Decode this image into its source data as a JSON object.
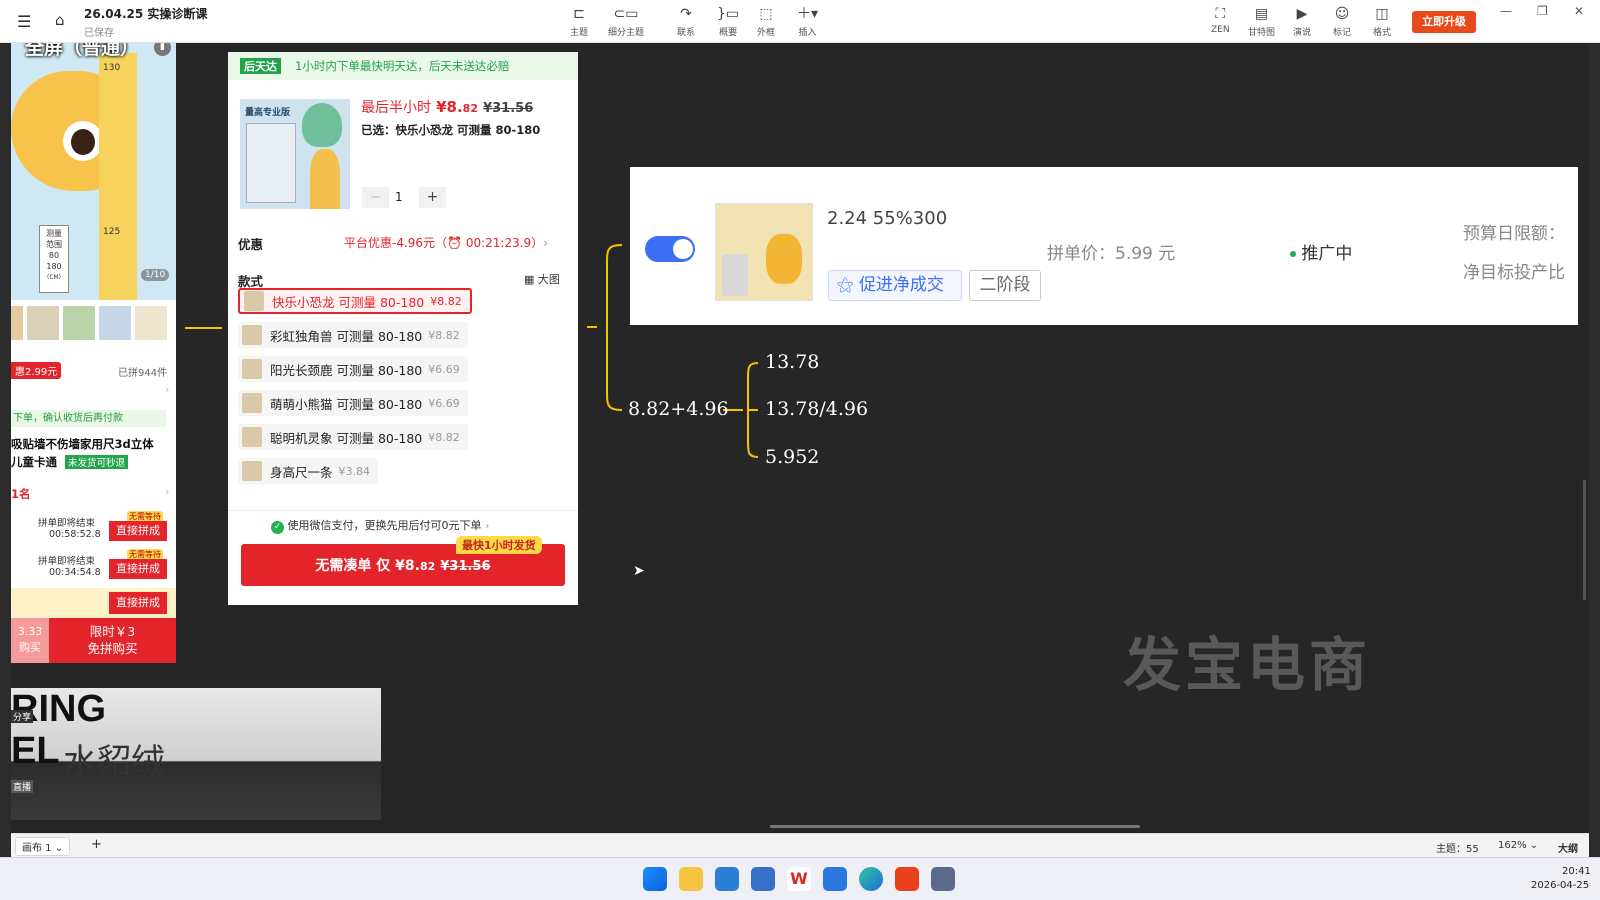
{
  "titlebar": {
    "doc_title": "26.04.25 实操诊断课",
    "save_status": "已保存",
    "upgrade_label": "立即升级"
  },
  "fullscreen_tag": "全屏（普通）",
  "toolbar": {
    "tools": [
      {
        "label": "主题",
        "icon": "topic-icon"
      },
      {
        "label": "细分主题",
        "icon": "subtopic-icon"
      },
      {
        "label": "联系",
        "icon": "relationship-icon"
      },
      {
        "label": "概要",
        "icon": "summary-icon"
      },
      {
        "label": "外框",
        "icon": "boundary-icon"
      },
      {
        "label": "插入",
        "icon": "insert-icon"
      }
    ],
    "right_tools": [
      {
        "label": "ZEN",
        "icon": "zen-icon"
      },
      {
        "label": "甘特图",
        "icon": "gantt-icon"
      },
      {
        "label": "演说",
        "icon": "present-icon"
      },
      {
        "label": "标记",
        "icon": "marker-icon"
      },
      {
        "label": "格式",
        "icon": "format-icon"
      }
    ]
  },
  "left_card": {
    "ruler_marks": [
      "130",
      "125"
    ],
    "measure_label_1": "测量",
    "measure_label_2": "范围",
    "measure_range_lo": "80",
    "measure_range_hi": "180",
    "measure_unit": "（CM）",
    "pager": "1/10",
    "coupon": "惠2.99元",
    "group_count": "已拼944件",
    "pay_later": "下单，确认收货后再付款",
    "desc_line1": "吸贴墙不伤墙家用尺3d立体",
    "desc_line2": "儿童卡通",
    "refund_tag": "未发货可秒退",
    "rank": "1名",
    "group_rows": [
      {
        "label": "拼单即将结束",
        "time": "00:58:52.8",
        "badge": "无需等待",
        "btn": "直接拼成"
      },
      {
        "label": "拼单即将结束",
        "time": "00:34:54.8",
        "badge": "无需等待",
        "btn": "直接拼成"
      }
    ],
    "join_btn": "直接拼成",
    "price_left": "3.33",
    "price_left_sub": "购买",
    "limited_line1": "限时￥3",
    "limited_line2": "免拼购买"
  },
  "bottom_image": {
    "line1": "RING",
    "line2": "EL",
    "line2_cn": "水貂绒",
    "side_tag_top": "分享",
    "side_tag_bottom": "直播"
  },
  "product": {
    "delivery_tag": "后天达",
    "delivery_text": "1小时内下单最快明天达，后天未送达必赔",
    "price_prefix": "最后半小时",
    "price_main": "¥8.",
    "price_cents": "82",
    "price_original": "¥31.56",
    "selected_text": "已选：快乐小恐龙 可测量 80-180",
    "qty_minus": "−",
    "qty_value": "1",
    "qty_plus": "+",
    "discount_label": "优惠",
    "discount_value": "平台优惠-4.96元（",
    "discount_timer": "00:21:23.9",
    "discount_close": "）",
    "style_label": "款式",
    "big_image": "大图",
    "variants": [
      {
        "name": "快乐小恐龙 可测量 80-180",
        "price": "¥8.82",
        "selected": true
      },
      {
        "name": "彩虹独角兽 可测量 80-180",
        "price": "¥8.82",
        "selected": false
      },
      {
        "name": "阳光长颈鹿 可测量 80-180",
        "price": "¥6.69",
        "selected": false
      },
      {
        "name": "萌萌小熊猫 可测量 80-180",
        "price": "¥6.69",
        "selected": false
      },
      {
        "name": "聪明机灵象 可测量 80-180",
        "price": "¥8.82",
        "selected": false
      },
      {
        "name": "身高尺一条",
        "price": "¥3.84",
        "selected": false
      }
    ],
    "pay_text": "使用微信支付，更换先用后付可0元下单",
    "fast_ship_badge": "最快1小时发货",
    "buy_btn_prefix": "无需凑单 仅 ¥8.",
    "buy_btn_cents": "82",
    "buy_btn_original": "¥31.56",
    "img_brand_title": "量高专业版"
  },
  "ad_panel": {
    "stats": "2.24 55%300",
    "group_price": "拼单价：5.99 元",
    "status": "推广中",
    "promote_btn": "促进净成交",
    "stage_btn": "二阶段",
    "budget_label": "预算日限额：",
    "roi_label": "净目标投产比"
  },
  "mindmap": {
    "root": "8.82+4.96",
    "mid": "13.78/4.96",
    "top": "13.78",
    "bottom": "5.952"
  },
  "watermark": "发宝电商",
  "statusbar": {
    "canvas_tab": "画布 1",
    "add_tab": "+",
    "topic_count": "主题：55",
    "zoom": "162%",
    "outline": "大纲"
  },
  "taskbar": {
    "time": "20:41",
    "date": "2026-04-25"
  },
  "colors": {
    "accent_red": "#e3242b",
    "toggle_blue": "#3d6ef5",
    "branch_yellow": "#f2c500",
    "delivery_green": "#22a34a"
  }
}
